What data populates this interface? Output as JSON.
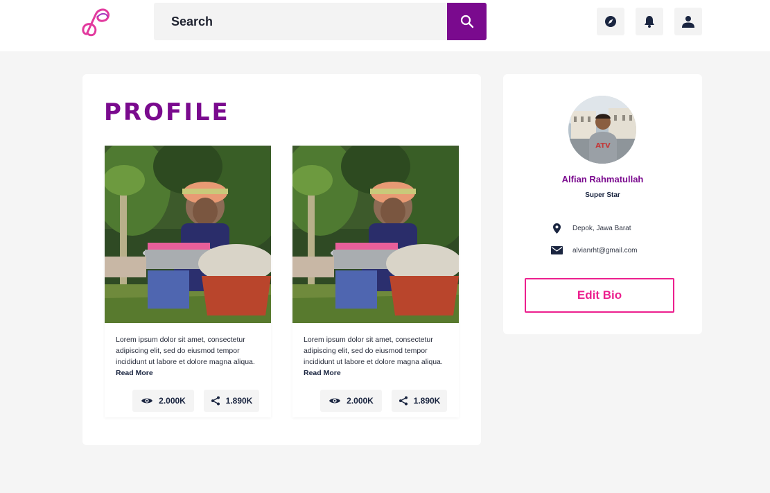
{
  "header": {
    "search_placeholder": "Search"
  },
  "main": {
    "title": "PROFILE",
    "posts": [
      {
        "text": "Lorem ipsum dolor sit amet, consectetur adipiscing elit, sed do eiusmod tempor incididunt ut labore et dolore magna aliqua.",
        "read_more": "Read More",
        "views": "2.000K",
        "shares": "1.890K"
      },
      {
        "text": "Lorem ipsum dolor sit amet, consectetur adipiscing elit, sed do eiusmod tempor incididunt ut labore et dolore magna aliqua.",
        "read_more": "Read More",
        "views": "2.000K",
        "shares": "1.890K"
      }
    ]
  },
  "profile": {
    "name": "Alfian Rahmatullah",
    "role": "Super Star",
    "location": "Depok, Jawa Barat",
    "email": "alvianrht@gmail.com",
    "edit_label": "Edit Bio"
  },
  "colors": {
    "brand": "#7a0a8e",
    "accent_pink": "#ec1f8e",
    "navy": "#1a2540",
    "background": "#f5f5f5"
  },
  "icons": [
    "logo-icon",
    "search-icon",
    "compass-icon",
    "bell-icon",
    "user-icon",
    "eye-icon",
    "share-icon",
    "location-pin-icon",
    "mail-icon"
  ]
}
